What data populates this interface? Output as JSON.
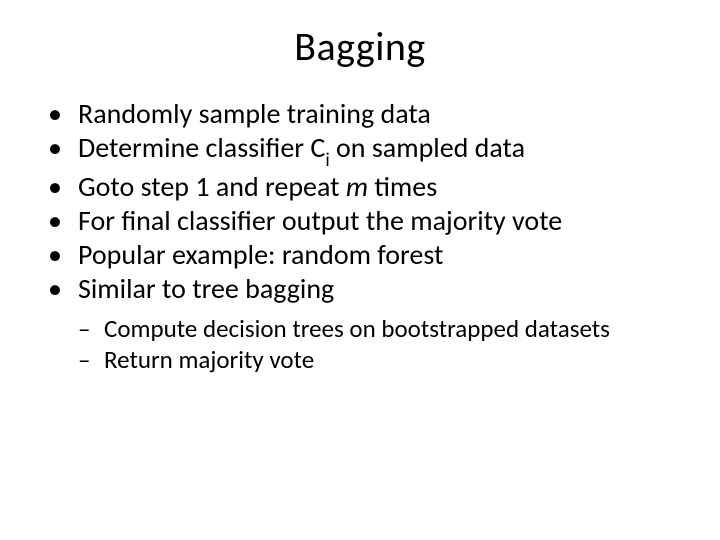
{
  "title": "Bagging",
  "bullets": {
    "b0": "Randomly sample training data",
    "b1_pre": "Determine classifier C",
    "b1_sub": "i",
    "b1_post": " on sampled data",
    "b2_pre": "Goto step 1 and repeat ",
    "b2_ital": "m",
    "b2_post": " times",
    "b3": "For final classifier output the majority vote",
    "b4": "Popular example: random forest",
    "b5": "Similar to tree bagging"
  },
  "sub": {
    "s0": "Compute decision trees on bootstrapped datasets",
    "s1": "Return majority vote"
  }
}
